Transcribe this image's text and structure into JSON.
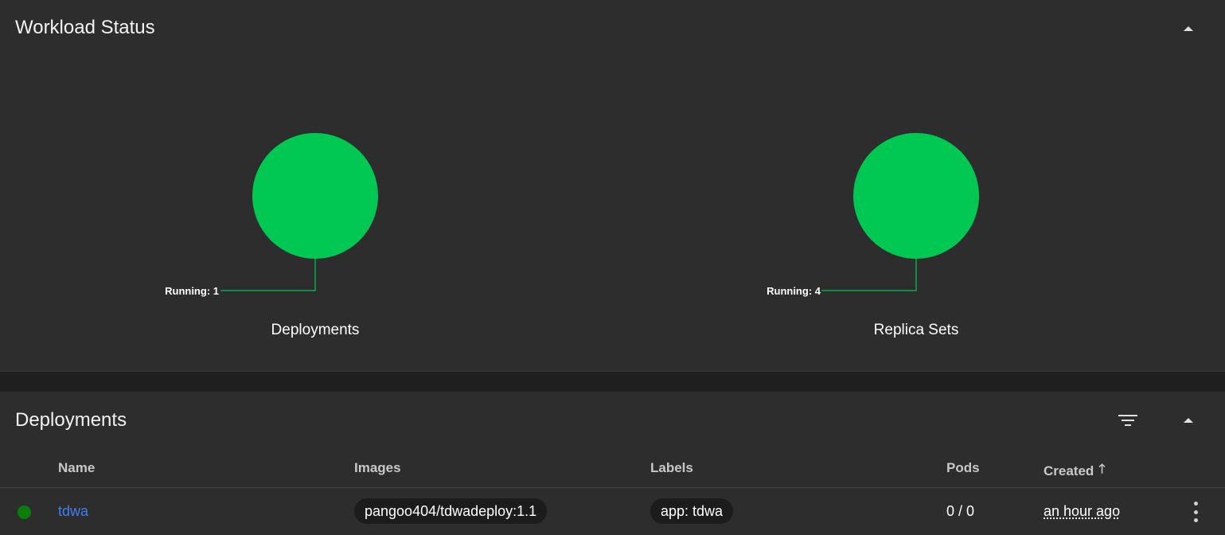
{
  "workload_status": {
    "title": "Workload Status",
    "charts": [
      {
        "caption": "Deployments",
        "legend": "Running: 1",
        "color": "#00c853"
      },
      {
        "caption": "Replica Sets",
        "legend": "Running: 4",
        "color": "#00c853"
      }
    ]
  },
  "chart_data": [
    {
      "type": "pie",
      "title": "Deployments",
      "categories": [
        "Running"
      ],
      "values": [
        1
      ],
      "colors": [
        "#00c853"
      ]
    },
    {
      "type": "pie",
      "title": "Replica Sets",
      "categories": [
        "Running"
      ],
      "values": [
        4
      ],
      "colors": [
        "#00c853"
      ]
    }
  ],
  "deployments": {
    "title": "Deployments",
    "icons": {
      "filter": "filter-list-icon",
      "collapse": "expand-less-icon",
      "sort": "arrow-upward-icon",
      "menu": "more-vert-icon"
    },
    "columns": {
      "name": "Name",
      "images": "Images",
      "labels": "Labels",
      "pods": "Pods",
      "created": "Created"
    },
    "rows": [
      {
        "status_color": "#0a7d0a",
        "name": "tdwa",
        "image": "pangoo404/tdwadeploy:1.1",
        "label": "app: tdwa",
        "pods": "0 / 0",
        "created": "an hour ago"
      }
    ]
  }
}
